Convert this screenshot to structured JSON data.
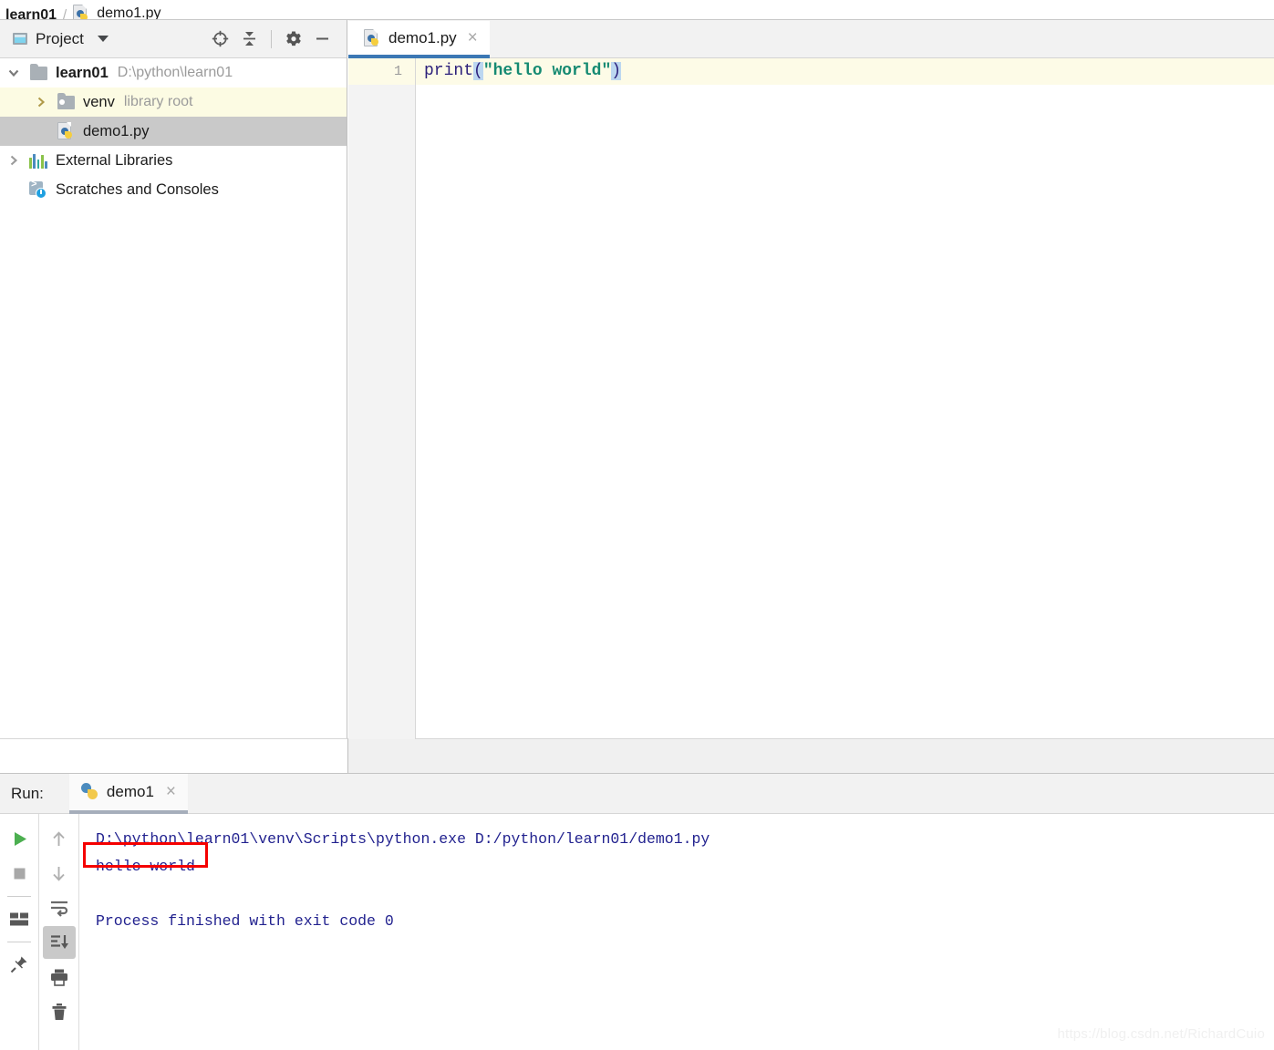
{
  "breadcrumb": {
    "project": "learn01",
    "separator": "/",
    "file": "demo1.py"
  },
  "project_panel": {
    "title": "Project",
    "icons": {
      "window": "project-window-icon",
      "dropdown": "chevron-down-icon",
      "locate": "locate-target-icon",
      "collapse_all": "collapse-all-icon",
      "settings": "gear-icon",
      "hide": "minimize-icon"
    },
    "tree": [
      {
        "label": "learn01",
        "sub": "D:\\python\\learn01",
        "icon": "folder-icon",
        "twisty": "expanded",
        "depth": 0,
        "bold": true,
        "state": "none"
      },
      {
        "label": "venv",
        "sub": "library root",
        "icon": "folder-library-icon",
        "twisty": "collapsed",
        "depth": 1,
        "bold": false,
        "state": "highlight"
      },
      {
        "label": "demo1.py",
        "sub": "",
        "icon": "python-file-icon",
        "twisty": "none",
        "depth": 1,
        "bold": false,
        "state": "selected"
      },
      {
        "label": "External Libraries",
        "sub": "",
        "icon": "external-libraries-icon",
        "twisty": "collapsed",
        "depth": 0,
        "bold": false,
        "state": "none"
      },
      {
        "label": "Scratches and Consoles",
        "sub": "",
        "icon": "scratches-icon",
        "twisty": "none",
        "depth": 0,
        "bold": false,
        "state": "none"
      }
    ]
  },
  "editor": {
    "tab": {
      "label": "demo1.py",
      "icon": "python-file-icon",
      "close": "×",
      "active": true
    },
    "line_number": "1",
    "code": {
      "fn": "print",
      "paren_open": "(",
      "string": "\"hello world\"",
      "paren_close": ")"
    },
    "colors": {
      "tab_underline": "#3c78b4",
      "current_line": "#fdfbe7",
      "keyword": "#2b1f7a",
      "string": "#158a72",
      "paren_match": "#bcd7f0"
    }
  },
  "run_panel": {
    "label": "Run:",
    "tab": {
      "label": "demo1",
      "icon": "python-logo-icon",
      "close": "×"
    },
    "toolbar_primary": [
      {
        "name": "rerun-button",
        "icon": "play-icon"
      },
      {
        "name": "stop-button",
        "icon": "stop-square-icon"
      },
      {
        "name": "separator",
        "icon": "separator"
      },
      {
        "name": "console-view-button",
        "icon": "console-layout-icon"
      },
      {
        "name": "separator",
        "icon": "separator"
      },
      {
        "name": "pin-tab-button",
        "icon": "pin-icon"
      }
    ],
    "toolbar_secondary": [
      {
        "name": "previous-occurrence-button",
        "icon": "arrow-up-icon",
        "active": false
      },
      {
        "name": "next-occurrence-button",
        "icon": "arrow-down-icon",
        "active": false
      },
      {
        "name": "soft-wrap-button",
        "icon": "soft-wrap-icon",
        "active": false
      },
      {
        "name": "scroll-to-end-button",
        "icon": "scroll-to-end-icon",
        "active": true
      },
      {
        "name": "print-button",
        "icon": "printer-icon",
        "active": false
      },
      {
        "name": "clear-all-button",
        "icon": "trash-icon",
        "active": false
      }
    ],
    "console": {
      "command": "D:\\python\\learn01\\venv\\Scripts\\python.exe D:/python/learn01/demo1.py",
      "output": "hello world",
      "blank": "",
      "exit": "Process finished with exit code 0",
      "text_color": "#22228f"
    },
    "annotation": {
      "target": "hello world",
      "color": "#f50000"
    }
  },
  "watermark": "https://blog.csdn.net/RichardCuio"
}
